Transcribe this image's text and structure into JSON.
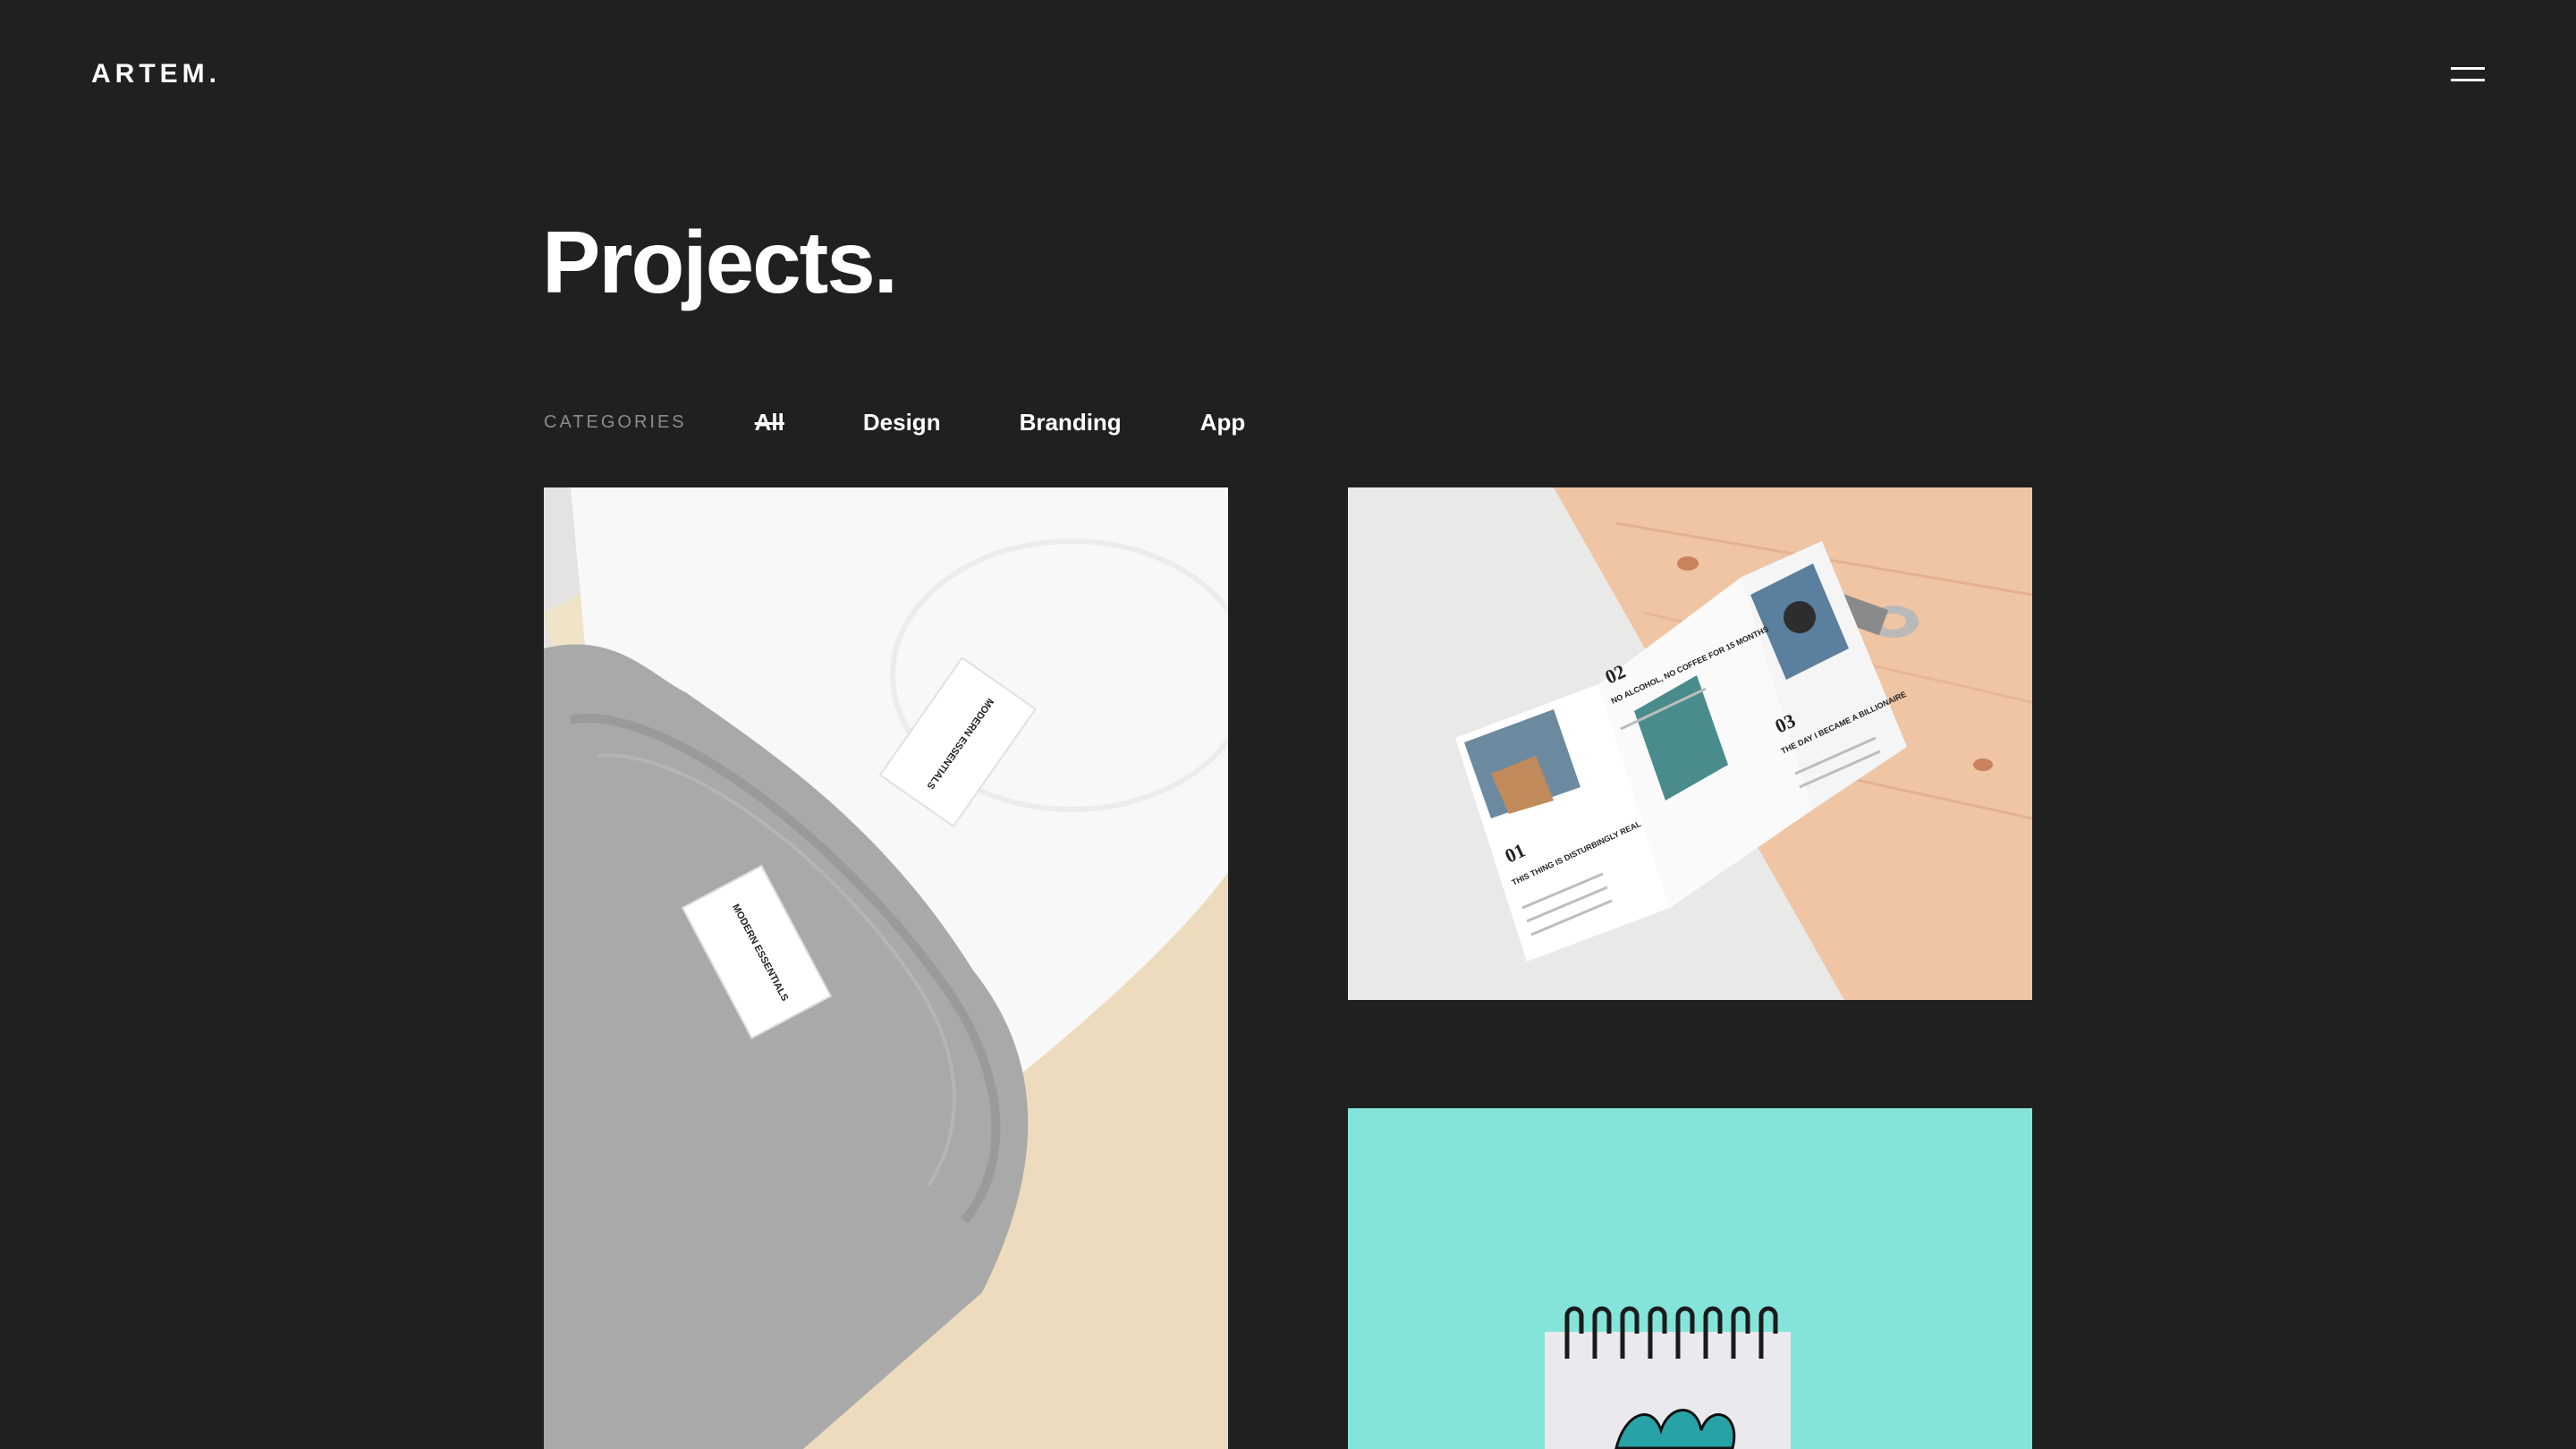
{
  "header": {
    "logo_text": "ARTEM.",
    "menu_icon": "hamburger-icon"
  },
  "main": {
    "title": "Projects.",
    "filters": {
      "label": "CATEGORIES",
      "items": [
        "All",
        "Design",
        "Branding",
        "App"
      ],
      "active": "All"
    },
    "projects": [
      {
        "image": "tshirts-mockup",
        "label_text": "MODERN ESSENTIALS",
        "label_text_2": "MODERN ESSENTIALS"
      },
      {
        "image": "brochure-mockup",
        "section_1_num": "01",
        "section_1_title": "THIS THING IS DISTURBINGLY REAL",
        "section_2_num": "02",
        "section_2_title": "NO ALCOHOL, NO COFFEE FOR 15 MONTHS",
        "section_3_num": "03",
        "section_3_title": "THE DAY I BECAME A BILLIONAIRE"
      },
      {
        "image": "notebook-mockup"
      }
    ]
  },
  "colors": {
    "background": "#202020",
    "text": "#ffffff",
    "muted": "#8c8c8c",
    "teal": "#84e4da"
  }
}
